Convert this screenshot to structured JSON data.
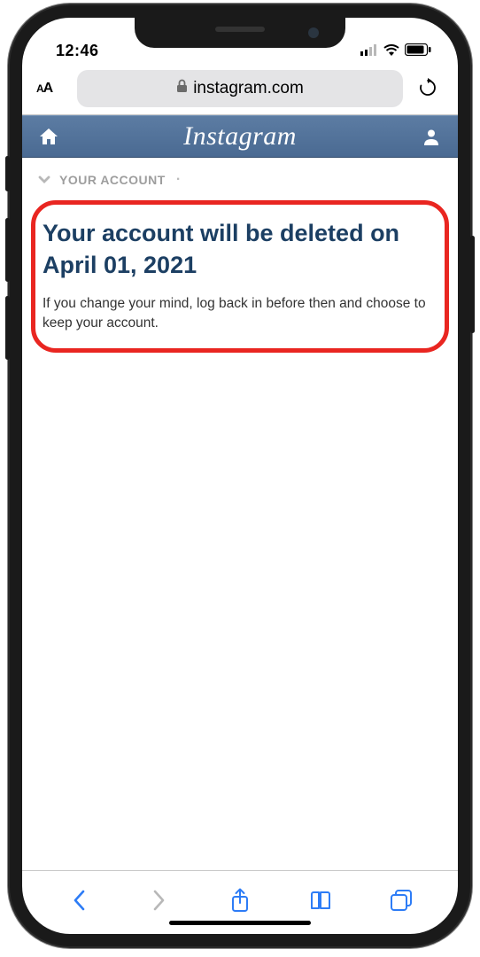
{
  "status": {
    "time": "12:46"
  },
  "safari": {
    "url_display": "instagram.com",
    "text_size_aria": "Text size"
  },
  "ig_header": {
    "logo": "Instagram"
  },
  "breadcrumb": {
    "label": "YOUR ACCOUNT",
    "sep": "·"
  },
  "content": {
    "heading": "Your account will be deleted on April 01, 2021",
    "body": "If you change your mind, log back in before then and choose to keep your account."
  },
  "colors": {
    "highlight_border": "#e92621",
    "ig_header_bg": "#51739b",
    "heading_text": "#1c3f63",
    "safari_accent": "#2d7cf6"
  }
}
